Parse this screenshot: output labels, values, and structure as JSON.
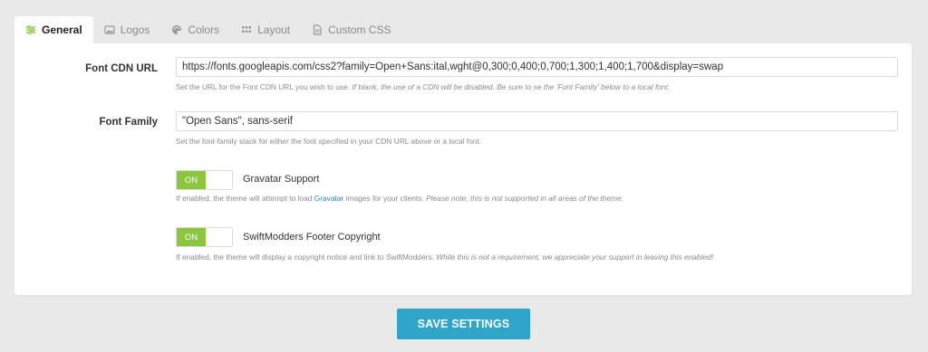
{
  "tabs": [
    {
      "label": "General",
      "icon": "sliders-icon",
      "active": true
    },
    {
      "label": "Logos",
      "icon": "image-icon",
      "active": false
    },
    {
      "label": "Colors",
      "icon": "palette-icon",
      "active": false
    },
    {
      "label": "Layout",
      "icon": "grid-icon",
      "active": false
    },
    {
      "label": "Custom CSS",
      "icon": "file-code-icon",
      "active": false
    }
  ],
  "font_cdn": {
    "label": "Font CDN URL",
    "value": "https://fonts.googleapis.com/css2?family=Open+Sans:ital,wght@0,300;0,400;0,700;1,300;1,400;1,700&display=swap",
    "help": "Set the URL for the Font CDN URL you wish to use.",
    "help_italic": "If blank, the use of a CDN will be disabled. Be sure to se the 'Font Family' below to a local font."
  },
  "font_family": {
    "label": "Font Family",
    "value": "\"Open Sans\", sans-serif",
    "help": "Set the font-family stack for either the font specified in your CDN URL above or a local font."
  },
  "gravatar": {
    "toggle": "ON",
    "label": "Gravatar Support",
    "help_pre": "If enabled, the theme will attempt to load",
    "help_link": "Gravatar",
    "help_post": "images for your clients.",
    "help_italic": "Please note, this is not supported in all areas of the theme."
  },
  "footer": {
    "toggle": "ON",
    "label": "SwiftModders Footer Copyright",
    "help": "If enabled, the theme will display a copyright notice and link to SwiftModders.",
    "help_italic": "While this is not a requirement, we appreciate your support in leaving this enabled!"
  },
  "save_label": "SAVE SETTINGS",
  "colors": {
    "accent": "#2fa5c9",
    "toggle_on": "#8cc63e",
    "active_icon": "#8cc63e",
    "link": "#2f8bb8"
  }
}
